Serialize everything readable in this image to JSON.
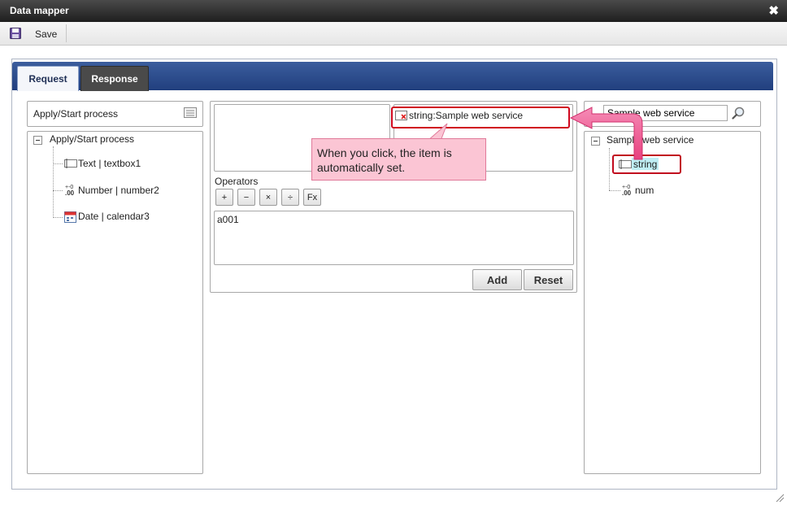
{
  "window": {
    "title": "Data mapper",
    "close_icon": "close-icon"
  },
  "toolbar": {
    "save_label": "Save",
    "save_icon": "floppy-disk-icon"
  },
  "tabs": [
    {
      "label": "Request",
      "active": true
    },
    {
      "label": "Response",
      "active": false
    }
  ],
  "left_panel": {
    "header": "Apply/Start process",
    "tree_root": "Apply/Start process",
    "items": [
      {
        "label": "Text | textbox1",
        "icon": "textbox-icon"
      },
      {
        "label": "Number | number2",
        "icon": "number-icon"
      },
      {
        "label": "Date | calendar3",
        "icon": "calendar-icon"
      }
    ]
  },
  "middle_panel": {
    "target_field": "string:Sample web service",
    "operators_label": "Operators",
    "operators": [
      "+",
      "−",
      "×",
      "÷",
      "Fx"
    ],
    "expression": "a001",
    "add_label": "Add",
    "reset_label": "Reset"
  },
  "right_panel": {
    "search_value": "Sample web service",
    "tree_root": "Sample web service",
    "items": [
      {
        "label": "string",
        "icon": "textbox-icon",
        "selected": true
      },
      {
        "label": "num",
        "icon": "number-icon",
        "selected": false
      }
    ]
  },
  "annotation": {
    "callout_text": "When you click, the item is automatically set.",
    "color": "#e8417f"
  },
  "colors": {
    "tab_bar": "#2b4a8a",
    "highlight_border": "#d0081f",
    "callout_bg": "#fbc5d4",
    "arrow": "#ec4b8b"
  }
}
